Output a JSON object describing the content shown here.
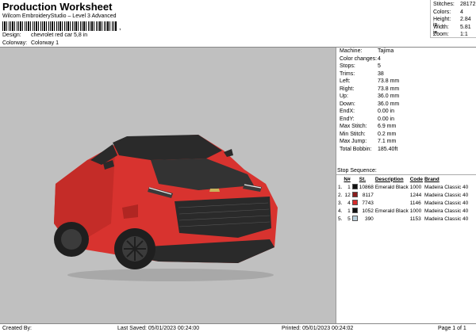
{
  "header": {
    "title": "Production Worksheet",
    "subtitle": "Wilcom EmbroideryStudio – Level 3 Advanced",
    "barcode_tail": ","
  },
  "meta": {
    "design_label": "Design:",
    "design_value": "chevrolet red car 5,8 in",
    "colorway_label": "Colorway:",
    "colorway_value": "Colorway 1"
  },
  "stats": [
    {
      "label": "Stitches:",
      "value": "28172"
    },
    {
      "label": "Colors:",
      "value": "4"
    },
    {
      "label": "Height:",
      "value": "2.84 in"
    },
    {
      "label": "Width:",
      "value": "5.81 in"
    },
    {
      "label": "Zoom:",
      "value": "1:1"
    }
  ],
  "machine_info": [
    {
      "label": "Machine:",
      "value": "Tajima"
    },
    {
      "label": "Color changes:",
      "value": "4"
    },
    {
      "label": "Stops:",
      "value": "5"
    },
    {
      "label": "Trims:",
      "value": "38"
    },
    {
      "label": "Left:",
      "value": "73.8 mm"
    },
    {
      "label": "Right:",
      "value": "73.8 mm"
    },
    {
      "label": "Up:",
      "value": "36.0 mm"
    },
    {
      "label": "Down:",
      "value": "36.0 mm"
    },
    {
      "label": "EndX:",
      "value": "0.00 in"
    },
    {
      "label": "EndY:",
      "value": "0.00 in"
    },
    {
      "label": "Max Stitch:",
      "value": "6.9 mm"
    },
    {
      "label": "Min Stitch:",
      "value": "0.2 mm"
    },
    {
      "label": "Max Jump:",
      "value": "7.1 mm"
    },
    {
      "label": "Total Bobbin:",
      "value": "185.40ft"
    }
  ],
  "stop_sequence": {
    "title": "Stop Sequence:",
    "headers": [
      "N#",
      "St.",
      "Description",
      "Code",
      "Brand"
    ],
    "rows": [
      {
        "stop": "1.",
        "n": "1",
        "color": "#111111",
        "st": "10868",
        "desc": "Emerald Black",
        "code": "1000",
        "brand": "Madeira Classic 40"
      },
      {
        "stop": "2.",
        "n": "12",
        "color": "#8a1c1c",
        "st": "8117",
        "desc": "",
        "code": "1244",
        "brand": "Madeira Classic 40"
      },
      {
        "stop": "3.",
        "n": "4",
        "color": "#d62b2b",
        "st": "7743",
        "desc": "",
        "code": "1146",
        "brand": "Madeira Classic 40"
      },
      {
        "stop": "4.",
        "n": "1",
        "color": "#111111",
        "st": "1052",
        "desc": "Emerald Black",
        "code": "1000",
        "brand": "Madeira Classic 40"
      },
      {
        "stop": "5.",
        "n": "5",
        "color": "#b9d0dc",
        "st": "390",
        "desc": "",
        "code": "1153",
        "brand": "Madeira Classic 40"
      }
    ]
  },
  "footer": {
    "created_by": "Created By:",
    "last_saved": "Last Saved: 05/01/2023 00:24:00",
    "printed": "Printed: 05/01/2023 00:24:02",
    "page": "Page 1 of 1"
  },
  "colors": {
    "preview_bg": "#c0c0c0",
    "car_body": "#d8332f",
    "car_dark": "#2a2a2a"
  }
}
